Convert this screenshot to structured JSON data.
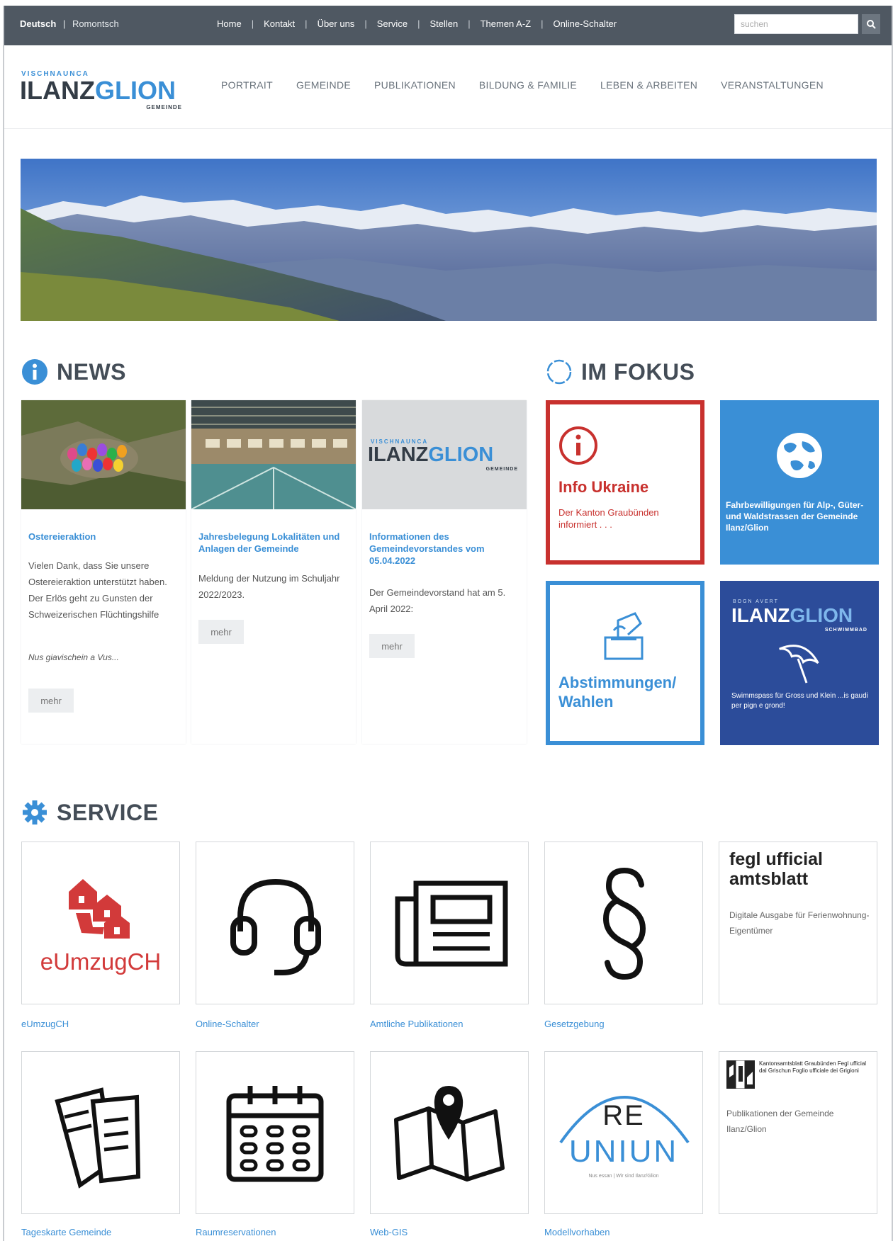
{
  "topbar": {
    "lang_active": "Deutsch",
    "lang_sep": "|",
    "lang_other": "Romontsch",
    "nav": [
      "Home",
      "Kontakt",
      "Über uns",
      "Service",
      "Stellen",
      "Themen A-Z",
      "Online-Schalter"
    ],
    "search_placeholder": "suchen"
  },
  "logo": {
    "top": "VISCHNAUNCA",
    "main_a": "ILANZ",
    "main_b": "GLION",
    "sub": "GEMEINDE"
  },
  "mainnav": [
    "PORTRAIT",
    "GEMEINDE",
    "PUBLIKATIONEN",
    "BILDUNG & FAMILIE",
    "LEBEN & ARBEITEN",
    "VERANSTALTUNGEN"
  ],
  "news": {
    "title": "NEWS",
    "items": [
      {
        "title": "Ostereieraktion",
        "text": "Vielen Dank, dass Sie unsere Ostereieraktion unterstützt haben. Der Erlös geht zu Gunsten der Schweizerischen Flüchtingshilfe",
        "extra": "Nus giavischein a Vus...",
        "more": "mehr"
      },
      {
        "title": "Jahresbelegung Lokalitäten und Anlagen der Gemeinde",
        "text": "Meldung der Nutzung im Schuljahr 2022/2023.",
        "more": "mehr"
      },
      {
        "title": "Informationen des Gemeindevorstandes vom 05.04.2022",
        "text": "Der Gemeindevorstand hat am 5. April 2022:",
        "more": "mehr"
      }
    ]
  },
  "focus": {
    "title": "IM FOKUS",
    "ukraine_title": "Info Ukraine",
    "ukraine_text": "Der Kanton Graubünden informiert . . .",
    "fahr_text": "Fahrbewilligungen für Alp-, Güter- und Waldstrassen der Gemeinde Ilanz/Glion",
    "abst_text": "Abstimmungen/ Wahlen",
    "bad_top": "BOGN AVERT",
    "bad_a": "ILANZ",
    "bad_b": "GLION",
    "bad_sub": "SCHWIMMBAD",
    "bad_text": "Swimmspass für Gross und Klein ...is gaudi per pign e grond!"
  },
  "service": {
    "title": "SERVICE",
    "row1": [
      {
        "label": "eUmzugCH",
        "tile": "eUmzugCH"
      },
      {
        "label": "Online-Schalter"
      },
      {
        "label": "Amtliche Publikationen"
      },
      {
        "label": "Gesetzgebung"
      },
      {
        "label": "",
        "tile_title_a": "fegl ufficial",
        "tile_title_b": "amtsblatt",
        "tile_text": "Digitale Ausgabe für Ferienwohnung-Eigentümer"
      }
    ],
    "row2": [
      {
        "label": "Tageskarte Gemeinde"
      },
      {
        "label": "Raumreservationen"
      },
      {
        "label": "Web-GIS"
      },
      {
        "label": "Modellvorhaben",
        "tile_a": "RE",
        "tile_b": "UNIUN",
        "tile_c": "Nus essan | Wir sind Ilanz/Glion"
      },
      {
        "label": "",
        "tile_head": "Kantonsamtsblatt Graubünden Fegl ufficial dal Grischun Foglio ufficiale dei Grigioni",
        "tile_text": "Publikationen der Gemeinde Ilanz/Glion"
      }
    ]
  }
}
